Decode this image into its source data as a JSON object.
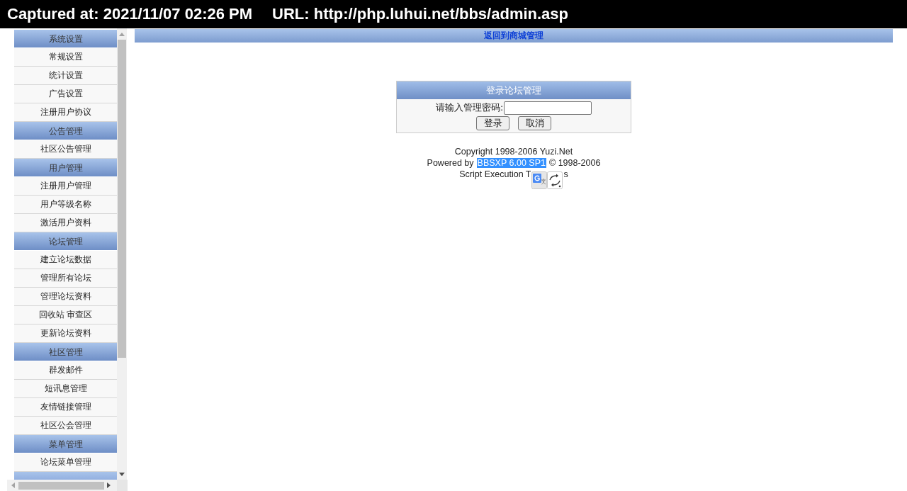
{
  "capture_bar": {
    "captured_at": "Captured at: 2021/11/07 02:26 PM",
    "url": "URL: http://php.luhui.net/bbs/admin.asp"
  },
  "sidebar": {
    "sections": [
      {
        "title": "系统设置",
        "items": [
          {
            "label": "常规设置"
          },
          {
            "label": "统计设置"
          },
          {
            "label": "广告设置"
          },
          {
            "label": "注册用户协议"
          }
        ]
      },
      {
        "title": "公告管理",
        "items": [
          {
            "label": "社区公告管理"
          }
        ]
      },
      {
        "title": "用户管理",
        "items": [
          {
            "label": "注册用户管理"
          },
          {
            "label": "用户等级名称"
          },
          {
            "label": "激活用户资料"
          }
        ]
      },
      {
        "title": "论坛管理",
        "items": [
          {
            "label": "建立论坛数据"
          },
          {
            "label": "管理所有论坛"
          },
          {
            "label": "管理论坛资料"
          },
          {
            "label": "回收站 审查区"
          },
          {
            "label": "更新论坛资料"
          }
        ]
      },
      {
        "title": "社区管理",
        "items": [
          {
            "label": "群发邮件"
          },
          {
            "label": "短讯息管理"
          },
          {
            "label": "友情链接管理"
          },
          {
            "label": "社区公会管理"
          }
        ]
      },
      {
        "title": "菜单管理",
        "items": [
          {
            "label": "论坛菜单管理"
          }
        ]
      }
    ],
    "partial_header_below": true
  },
  "top_link": "返回到商城管理",
  "login": {
    "title": "登录论坛管理",
    "password_label": "请输入管理密码:",
    "buttons": [
      "登录",
      "取消"
    ]
  },
  "footer": {
    "copyright": "Copyright 1998-2006 Yuzi.Net",
    "powered_by": "Powered by",
    "version": {
      "text": "BBSXP 6.00 SP1",
      "selected": true
    },
    "version_years": "© 1998-2006",
    "execution_time": "Script Execution T",
    "execution_time_end": "s"
  }
}
